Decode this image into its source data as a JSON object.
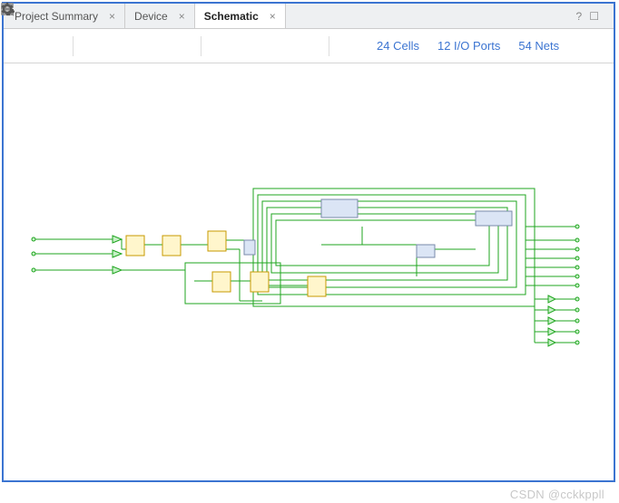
{
  "tabs": [
    {
      "label": "Project Summary"
    },
    {
      "label": "Device"
    },
    {
      "label": "Schematic"
    }
  ],
  "active_tab": "Schematic",
  "counts": {
    "cells": "24 Cells",
    "io": "12 I/O Ports",
    "nets": "54 Nets"
  },
  "watermark": "CSDN @cckkppll",
  "title_icons": {
    "help": "?",
    "maximize": "☐",
    "popout": "⇱"
  },
  "icons": {
    "back": "back-icon",
    "forward": "forward-icon",
    "zoom_in": "zoom-in-icon",
    "zoom_out": "zoom-out-icon",
    "zoom_fit": "zoom-fit-icon",
    "zoom_area": "zoom-area-icon",
    "target": "target-icon",
    "shrink": "shrink-icon",
    "plus": "plus-icon",
    "minus": "minus-icon",
    "reload": "reload-icon",
    "gear": "gear-icon"
  }
}
